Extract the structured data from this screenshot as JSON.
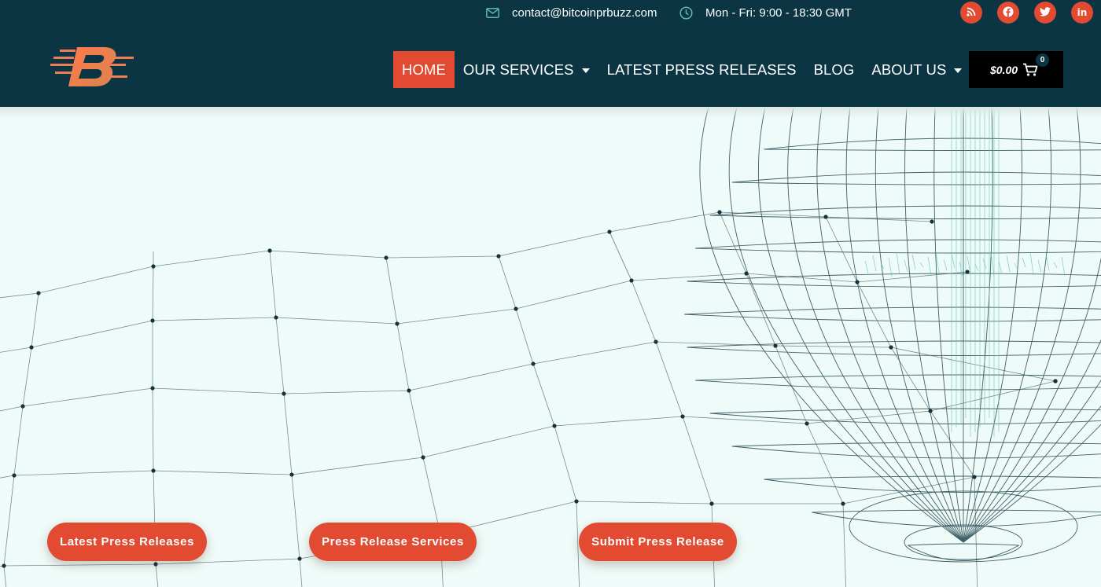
{
  "topbar": {
    "email": "contact@bitcoinprbuzz.com",
    "hours": "Mon - Fri: 9:00 - 18:30 GMT",
    "social": [
      {
        "name": "rss",
        "icon": "rss-icon"
      },
      {
        "name": "facebook",
        "icon": "facebook-icon"
      },
      {
        "name": "twitter",
        "icon": "twitter-icon"
      },
      {
        "name": "linkedin",
        "icon": "linkedin-icon",
        "glyph": "in"
      }
    ]
  },
  "logo": {
    "letter": "B",
    "icon": "bitcoinprbuzz-logo"
  },
  "nav": {
    "items": [
      {
        "label": "HOME",
        "active": true,
        "dropdown": false
      },
      {
        "label": "OUR SERVICES",
        "active": false,
        "dropdown": true
      },
      {
        "label": "LATEST PRESS RELEASES",
        "active": false,
        "dropdown": false
      },
      {
        "label": "BLOG",
        "active": false,
        "dropdown": false
      },
      {
        "label": "ABOUT US",
        "active": false,
        "dropdown": true
      }
    ]
  },
  "cart": {
    "total": "$0.00",
    "count": "0",
    "icon": "cart-icon"
  },
  "hero": {
    "buttons": [
      {
        "label": "Latest Press Releases"
      },
      {
        "label": "Press Release Services"
      },
      {
        "label": "Submit Press Release"
      }
    ],
    "background": "network-grid-and-wireframe-globe"
  },
  "colors": {
    "header_bg": "#0b3542",
    "accent": "#e24a31",
    "hero_bg": "#eefbf8",
    "cart_bg": "#000000"
  }
}
